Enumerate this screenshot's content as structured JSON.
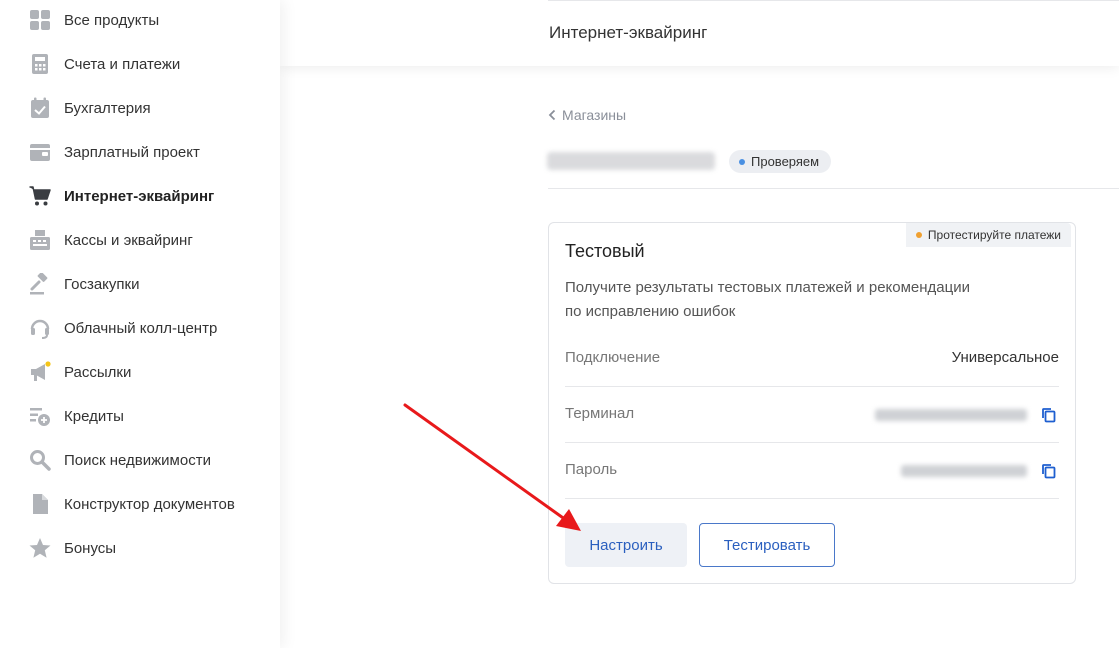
{
  "sidebar": {
    "items": [
      {
        "label": "Все продукты",
        "icon": "grid-icon"
      },
      {
        "label": "Счета и платежи",
        "icon": "calculator-icon"
      },
      {
        "label": "Бухгалтерия",
        "icon": "calendar-check-icon"
      },
      {
        "label": "Зарплатный проект",
        "icon": "wallet-icon"
      },
      {
        "label": "Интернет-эквайринг",
        "icon": "cart-icon",
        "active": true
      },
      {
        "label": "Кассы и эквайринг",
        "icon": "cash-register-icon"
      },
      {
        "label": "Госзакупки",
        "icon": "gavel-icon"
      },
      {
        "label": "Облачный колл-центр",
        "icon": "headset-icon"
      },
      {
        "label": "Рассылки",
        "icon": "megaphone-icon"
      },
      {
        "label": "Кредиты",
        "icon": "credit-plus-icon"
      },
      {
        "label": "Поиск недвижимости",
        "icon": "magnifier-icon"
      },
      {
        "label": "Конструктор документов",
        "icon": "document-icon"
      },
      {
        "label": "Бонусы",
        "icon": "star-icon"
      }
    ]
  },
  "header": {
    "title": "Интернет-эквайринг"
  },
  "breadcrumb": {
    "back_label": "Магазины"
  },
  "shop": {
    "status": "Проверяем"
  },
  "card": {
    "badge": "Протестируйте платежи",
    "title": "Тестовый",
    "description_line1": "Получите результаты тестовых платежей и рекомендации",
    "description_line2": "по исправлению ошибок",
    "rows": [
      {
        "label": "Подключение",
        "value": "Универсальное"
      },
      {
        "label": "Терминал"
      },
      {
        "label": "Пароль"
      }
    ],
    "buttons": {
      "configure": "Настроить",
      "test": "Тестировать"
    }
  },
  "colors": {
    "accent": "#2a5fbf",
    "status_dot": "#4a90e2",
    "badge_dot": "#f0a030",
    "annotation_arrow": "#e8191b",
    "icon_gray": "#b0b3b8",
    "active_icon": "#3a3d42"
  }
}
